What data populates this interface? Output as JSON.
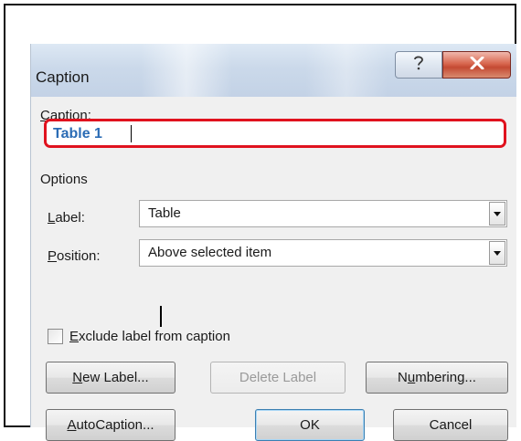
{
  "window": {
    "title": "Caption",
    "help_icon": "question-mark-icon",
    "close_icon": "close-x-icon"
  },
  "caption": {
    "label": "Caption:",
    "value": "Table 1",
    "highlight_color": "#e0121e"
  },
  "options": {
    "heading": "Options",
    "label_field": {
      "label": "Label:",
      "value": "Table"
    },
    "position_field": {
      "label": "Position:",
      "value": "Above selected item"
    },
    "exclude_checkbox": {
      "label": "Exclude label from caption",
      "checked": false
    }
  },
  "buttons": {
    "new_label": "New Label...",
    "delete_label": "Delete Label",
    "numbering": "Numbering...",
    "autocaption": "AutoCaption...",
    "ok": "OK",
    "cancel": "Cancel"
  },
  "colors": {
    "title_bar": "#cbd9ea",
    "close_button": "#c44a33",
    "caption_text": "#2b6cb5"
  }
}
